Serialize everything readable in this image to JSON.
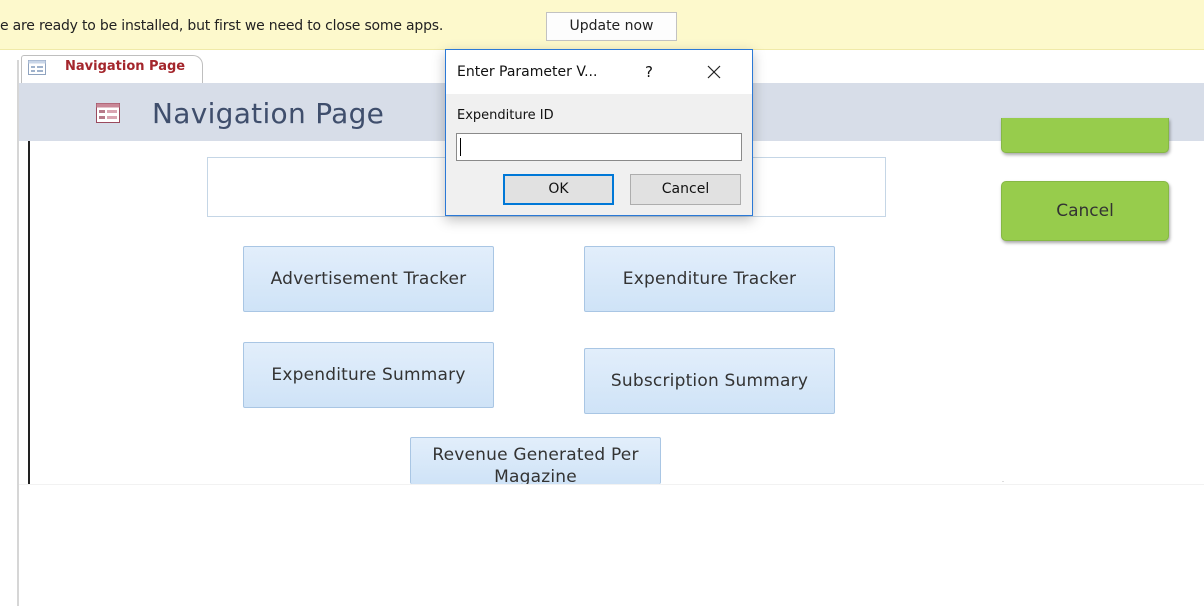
{
  "notification": {
    "message": "e are ready to be installed, but first we need to close some apps.",
    "update_button": "Update now"
  },
  "document_tab": {
    "label": "Navigation Page",
    "icon": "form-icon"
  },
  "form": {
    "title": "Navigation Page",
    "icon": "form-icon",
    "buttons": {
      "advertisement_tracker": "Advertisement Tracker",
      "expenditure_tracker": "Expenditure Tracker",
      "expenditure_summary": "Expenditure Summary",
      "subscription_summary": "Subscription Summary",
      "revenue_generated": "Revenue Generated Per Magazine"
    },
    "side_buttons": {
      "top": "",
      "cancel": "Cancel"
    }
  },
  "dialog": {
    "title": "Enter Parameter V...",
    "help": "?",
    "prompt": "Expenditure ID",
    "input_value": "",
    "ok": "OK",
    "cancel": "Cancel"
  },
  "colors": {
    "notification_bg": "#fdf9cc",
    "header_bg": "#d7dde8",
    "title_text": "#3f4e6c",
    "tab_text": "#a4262c",
    "nav_button": "#d9e9f9",
    "green_button": "#97cc4c",
    "dialog_accent": "#0078d7"
  }
}
